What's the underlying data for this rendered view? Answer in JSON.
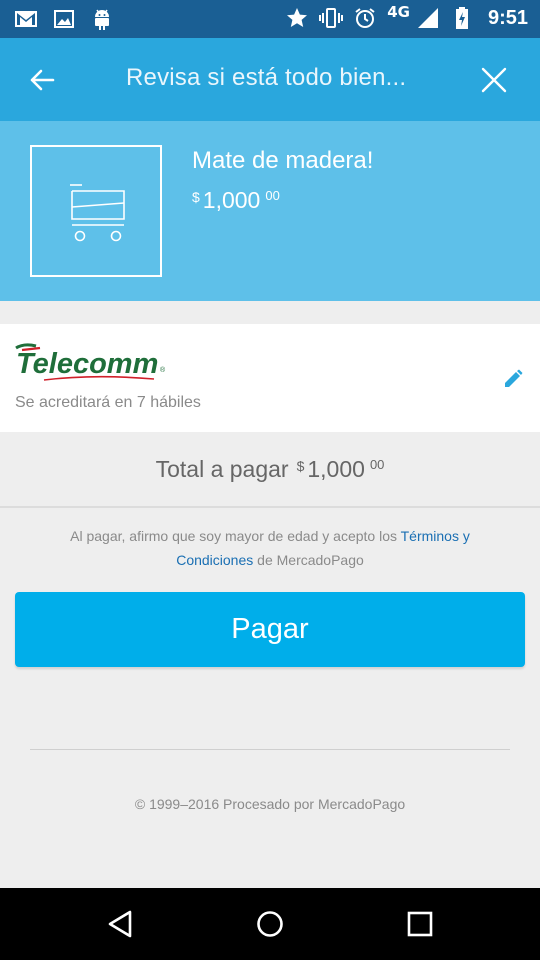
{
  "status_bar": {
    "network": "4G",
    "time": "9:51",
    "icons": [
      "gmail-icon",
      "gallery-icon",
      "android-icon",
      "star-icon",
      "vibrate-icon",
      "alarm-icon",
      "signal-icon",
      "battery-charging-icon"
    ]
  },
  "app_bar": {
    "title": "Revisa si está todo bien...",
    "back_icon": "arrow-back-icon",
    "close_icon": "close-icon"
  },
  "product": {
    "name": "Mate de madera!",
    "price": {
      "currency": "$",
      "integer": "1,000",
      "cents": "00"
    },
    "thumbnail_icon": "cart-icon"
  },
  "payment_method": {
    "logo_text": "Telecomm",
    "logo_mark": "®",
    "subtitle": "Se acreditará en 7 hábiles",
    "edit_icon": "pencil-icon"
  },
  "total": {
    "label": "Total a pagar",
    "price": {
      "currency": "$",
      "integer": "1,000",
      "cents": "00"
    }
  },
  "legal": {
    "text_before": "Al pagar, afirmo que soy mayor de edad y acepto los ",
    "link": "Términos y Condiciones",
    "text_after": " de MercadoPago"
  },
  "pay_button": {
    "label": "Pagar"
  },
  "footer": {
    "text": "© 1999–2016 Procesado por MercadoPago"
  },
  "colors": {
    "status_bar": "#1a5f94",
    "app_bar": "#2aa7dd",
    "product_panel": "#5ec0e9",
    "accent": "#00aeea",
    "link": "#1a6fb3",
    "logo_red": "#d0202a",
    "logo_green": "#1f6e3a"
  }
}
